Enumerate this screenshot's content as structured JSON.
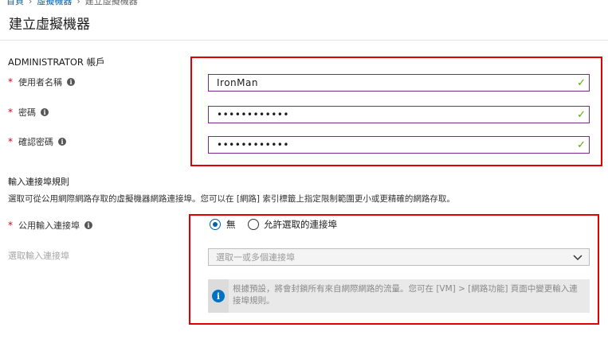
{
  "breadcrumb": {
    "items": [
      "首頁",
      "虛擬機器",
      "建立虛擬機器"
    ]
  },
  "page": {
    "title": "建立虛擬機器"
  },
  "administrator": {
    "section_title": "ADMINISTRATOR 帳戶",
    "username": {
      "label": "使用者名稱",
      "value": "IronMan",
      "valid": true
    },
    "password": {
      "label": "密碼",
      "value": "••••••••••••",
      "valid": true
    },
    "confirm_password": {
      "label": "確認密碼",
      "value": "••••••••••••",
      "valid": true
    }
  },
  "inbound": {
    "section_title": "輸入連接埠規則",
    "description": "選取可從公用網際網路存取的虛擬機器網路連接埠。您可以在 [網路] 索引標籤上指定限制範圍更小或更精確的網路存取。",
    "public_ports": {
      "label": "公用輸入連接埠",
      "options": [
        "無",
        "允許選取的連接埠"
      ],
      "selected": "無"
    },
    "select_ports": {
      "label": "選取輸入連接埠",
      "placeholder": "選取一或多個連接埠"
    },
    "info_text": "根據預設，將會封鎖所有來自網際網路的流量。您可在 [VM] > [網路功能] 頁面中變更輸入連接埠規則。"
  },
  "colors": {
    "highlight_border": "#e00000",
    "valid_check": "#5aa700",
    "focus_border": "#7a2a8c",
    "link": "#0062ad",
    "info_icon": "#0072c6"
  },
  "icons": {
    "info": "info-icon",
    "check": "checkmark-icon",
    "dropdown": "chevron-down-icon"
  }
}
